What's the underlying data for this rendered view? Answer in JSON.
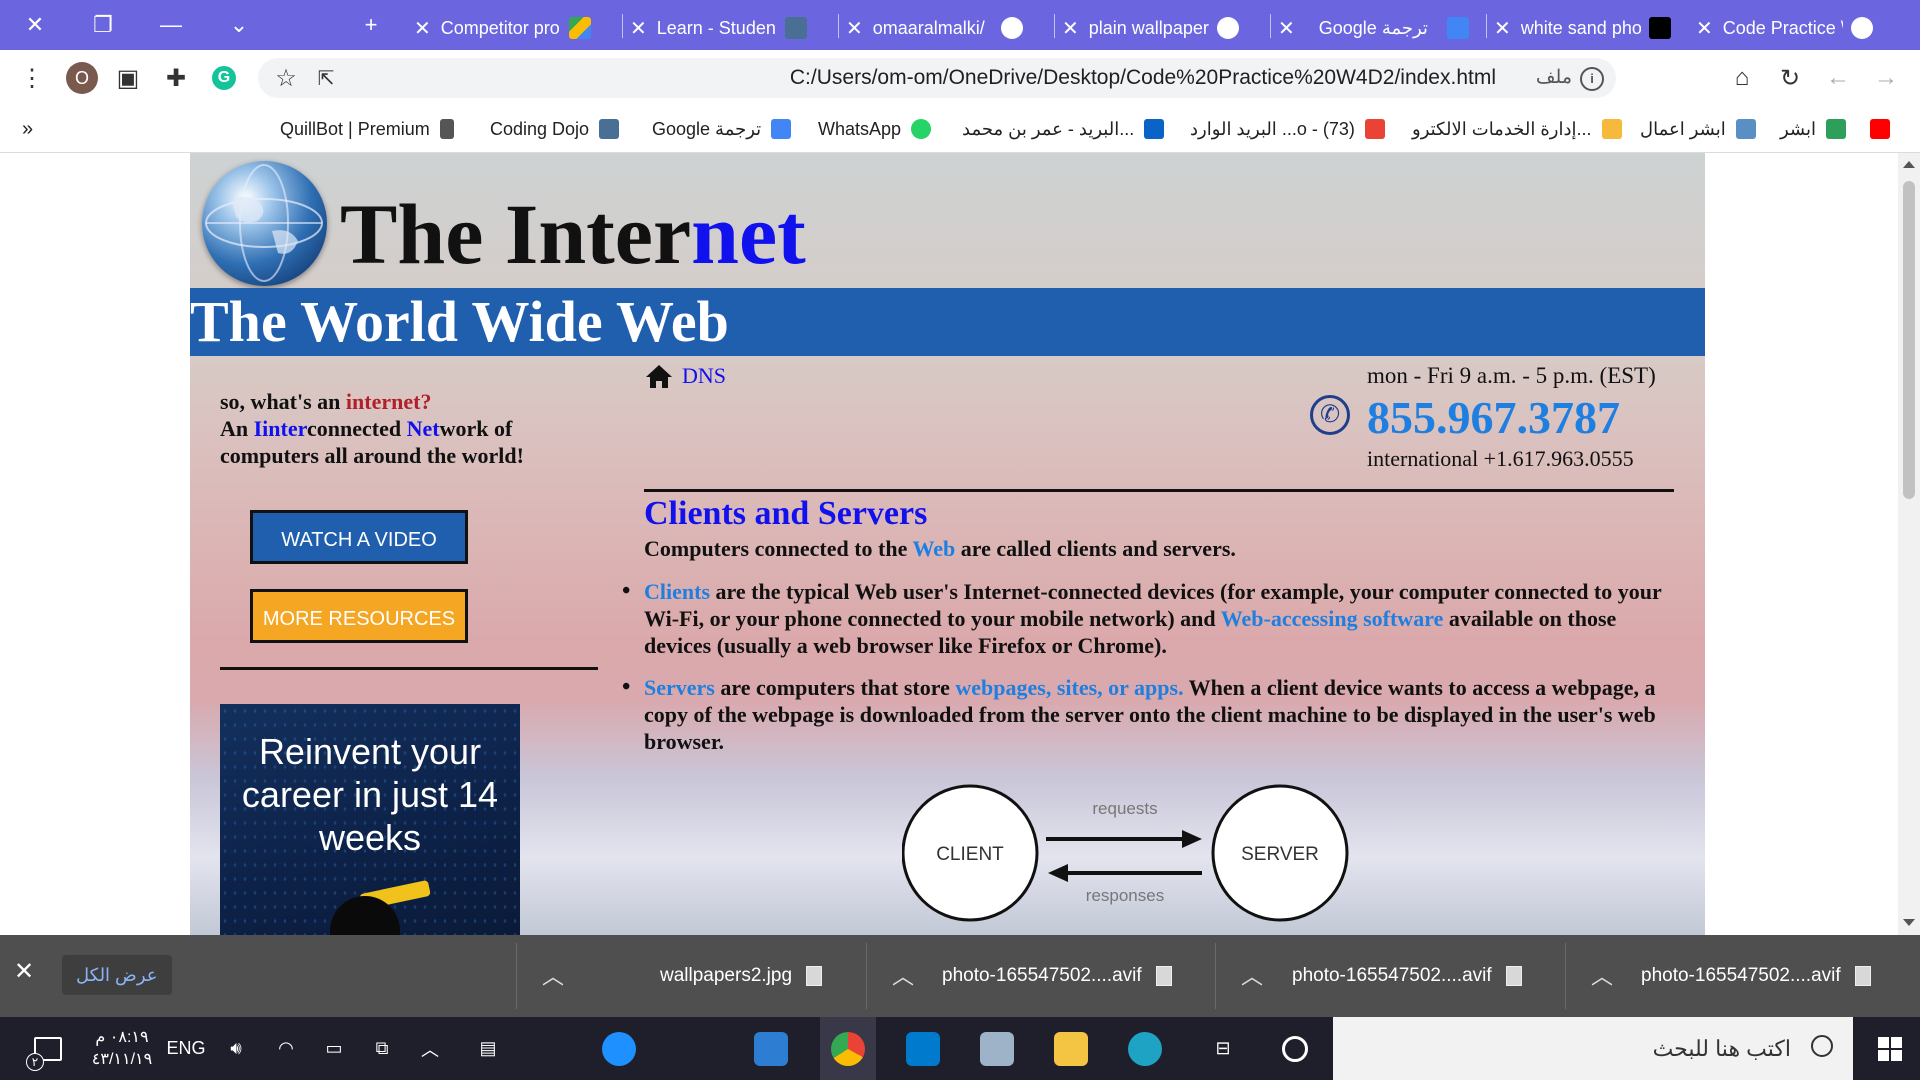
{
  "tabs": [
    {
      "title": "Code Practice \\",
      "active": true
    },
    {
      "title": "white sand pho"
    },
    {
      "title": "Google ترجمة"
    },
    {
      "title": "plain wallpaper"
    },
    {
      "title": "omaaralmalki/"
    },
    {
      "title": "Learn - Studen"
    },
    {
      "title": "Competitor pro"
    }
  ],
  "toolbar": {
    "url": "C:/Users/om-om/OneDrive/Desktop/Code%20Practice%20W4D2/index.html",
    "file_label": "ملف",
    "profile_initial": "O"
  },
  "bookmarks": [
    {
      "label": "ابشر"
    },
    {
      "label": "ابشر اعمال"
    },
    {
      "label": "إدارة الخدمات الالكترو..."
    },
    {
      "label": "البريد الوارد ...ο - (73)"
    },
    {
      "label": "البريد - عمر بن محمد..."
    },
    {
      "label": "WhatsApp"
    },
    {
      "label": "Google ترجمة"
    },
    {
      "label": "Coding Dojo"
    },
    {
      "label": "QuillBot | Premium"
    },
    {
      "label": "»"
    }
  ],
  "site": {
    "title_part1": "The Inter",
    "title_part2": "net",
    "banner": "The World Wide Web",
    "intro": {
      "q1": "so, what's an ",
      "q2": "internet?",
      "l1": "An ",
      "l2": "Iinter",
      "l3": "connected ",
      "l4": "Net",
      "l5": "work of computers all around the world!"
    },
    "watch_button": "WATCH A VIDEO",
    "resources_button": "MORE RESOURCES",
    "ad_text": "Reinvent your career in just 14 weeks",
    "dns_link": "DNS",
    "hours": "mon - Fri 9 a.m. - 5 p.m. (EST)",
    "phone": "855.967.3787",
    "intl_phone": "international +1.617.963.0555",
    "section_title": "Clients and Servers",
    "section_sub_1": "Computers connected to the ",
    "section_sub_web": "Web",
    "section_sub_2": " are called clients and servers.",
    "bullet1": {
      "k1": "Clients",
      "t1": " are the typical Web user's Internet-connected devices (for example, your computer connected to your Wi-Fi, or your phone connected to your mobile network) and ",
      "k2": "Web-accessing software",
      "t2": " available on those devices (usually a web browser like Firefox or Chrome)."
    },
    "bullet2": {
      "k1": "Servers",
      "t1": " are computers that store ",
      "k2": "webpages, sites, or apps.",
      "t2": " When a client device wants to access a webpage, a copy of the webpage is downloaded from the server onto the client machine to be displayed in the user's web browser."
    },
    "diagram": {
      "client": "CLIENT",
      "server": "SERVER",
      "requests": "requests",
      "responses": "responses"
    }
  },
  "downloads": {
    "show_all": "عرض الكل",
    "items": [
      "photo-165547502....avif",
      "photo-165547502....avif",
      "photo-165547502....avif",
      "wallpapers2.jpg"
    ]
  },
  "taskbar": {
    "search_placeholder": "اكتب هنا للبحث",
    "lang": "ENG",
    "time": "٠٨:١٩ م",
    "date": "٤٣/١١/١٩",
    "notif_count": "٢"
  },
  "colors": {
    "tabbar": "#6b66df",
    "banner": "#1f5fae",
    "watch_button": "#1f5fae",
    "resources_button": "#f5a623",
    "link_blue": "#1f7fe0"
  }
}
